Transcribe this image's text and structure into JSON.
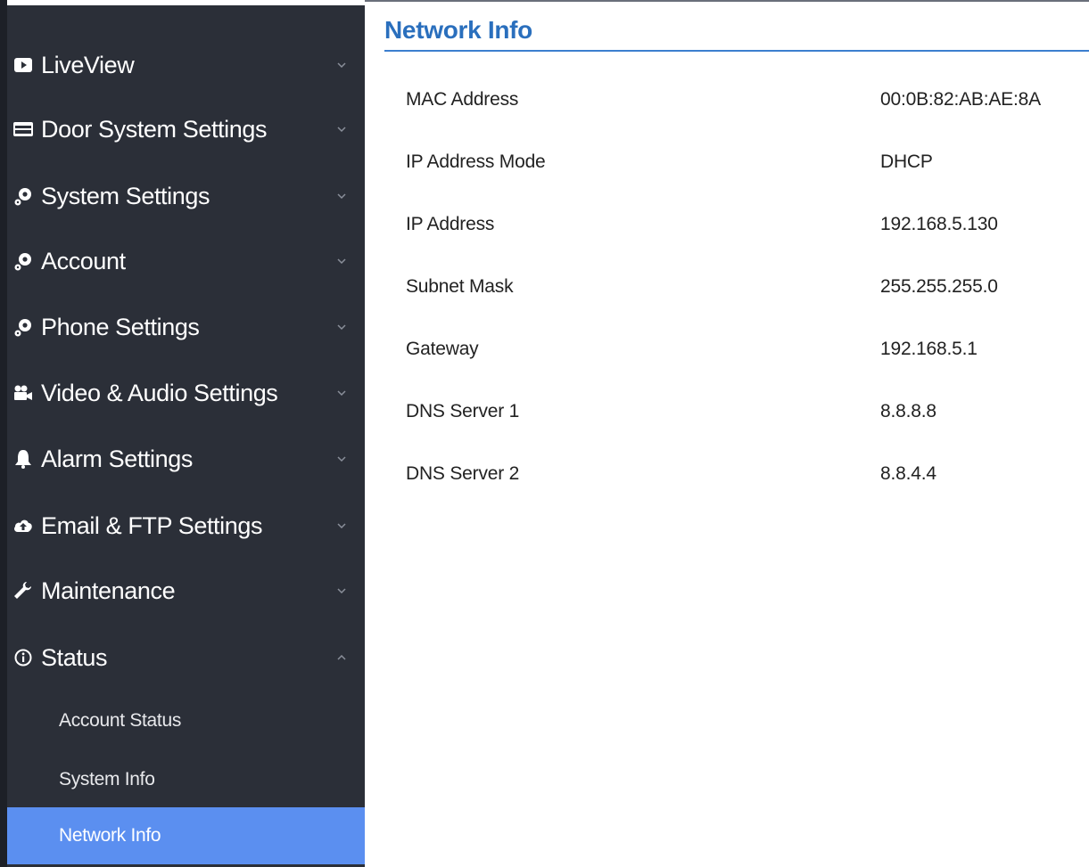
{
  "sidebar": {
    "items": [
      {
        "label": "LiveView",
        "icon": "video-icon"
      },
      {
        "label": "Door System Settings",
        "icon": "card-icon"
      },
      {
        "label": "System Settings",
        "icon": "gears-icon"
      },
      {
        "label": "Account",
        "icon": "gears-icon"
      },
      {
        "label": "Phone Settings",
        "icon": "gears-icon"
      },
      {
        "label": "Video & Audio Settings",
        "icon": "camera-icon"
      },
      {
        "label": "Alarm Settings",
        "icon": "bell-icon"
      },
      {
        "label": "Email & FTP Settings",
        "icon": "cloud-upload-icon"
      },
      {
        "label": "Maintenance",
        "icon": "wrench-icon"
      },
      {
        "label": "Status",
        "icon": "info-icon"
      }
    ],
    "status_subitems": [
      {
        "label": "Account Status",
        "active": false
      },
      {
        "label": "System Info",
        "active": false
      },
      {
        "label": "Network Info",
        "active": true
      }
    ]
  },
  "main": {
    "title": "Network Info",
    "rows": [
      {
        "key": "MAC Address",
        "value": "00:0B:82:AB:AE:8A"
      },
      {
        "key": "IP Address Mode",
        "value": "DHCP"
      },
      {
        "key": "IP Address",
        "value": "192.168.5.130"
      },
      {
        "key": "Subnet Mask",
        "value": "255.255.255.0"
      },
      {
        "key": "Gateway",
        "value": "192.168.5.1"
      },
      {
        "key": "DNS Server 1",
        "value": "8.8.8.8"
      },
      {
        "key": "DNS Server 2",
        "value": "8.8.4.4"
      }
    ]
  },
  "colors": {
    "sidebar_bg": "#2b2f38",
    "active_bg": "#5b8ff0",
    "title_blue": "#2a6fbd"
  }
}
